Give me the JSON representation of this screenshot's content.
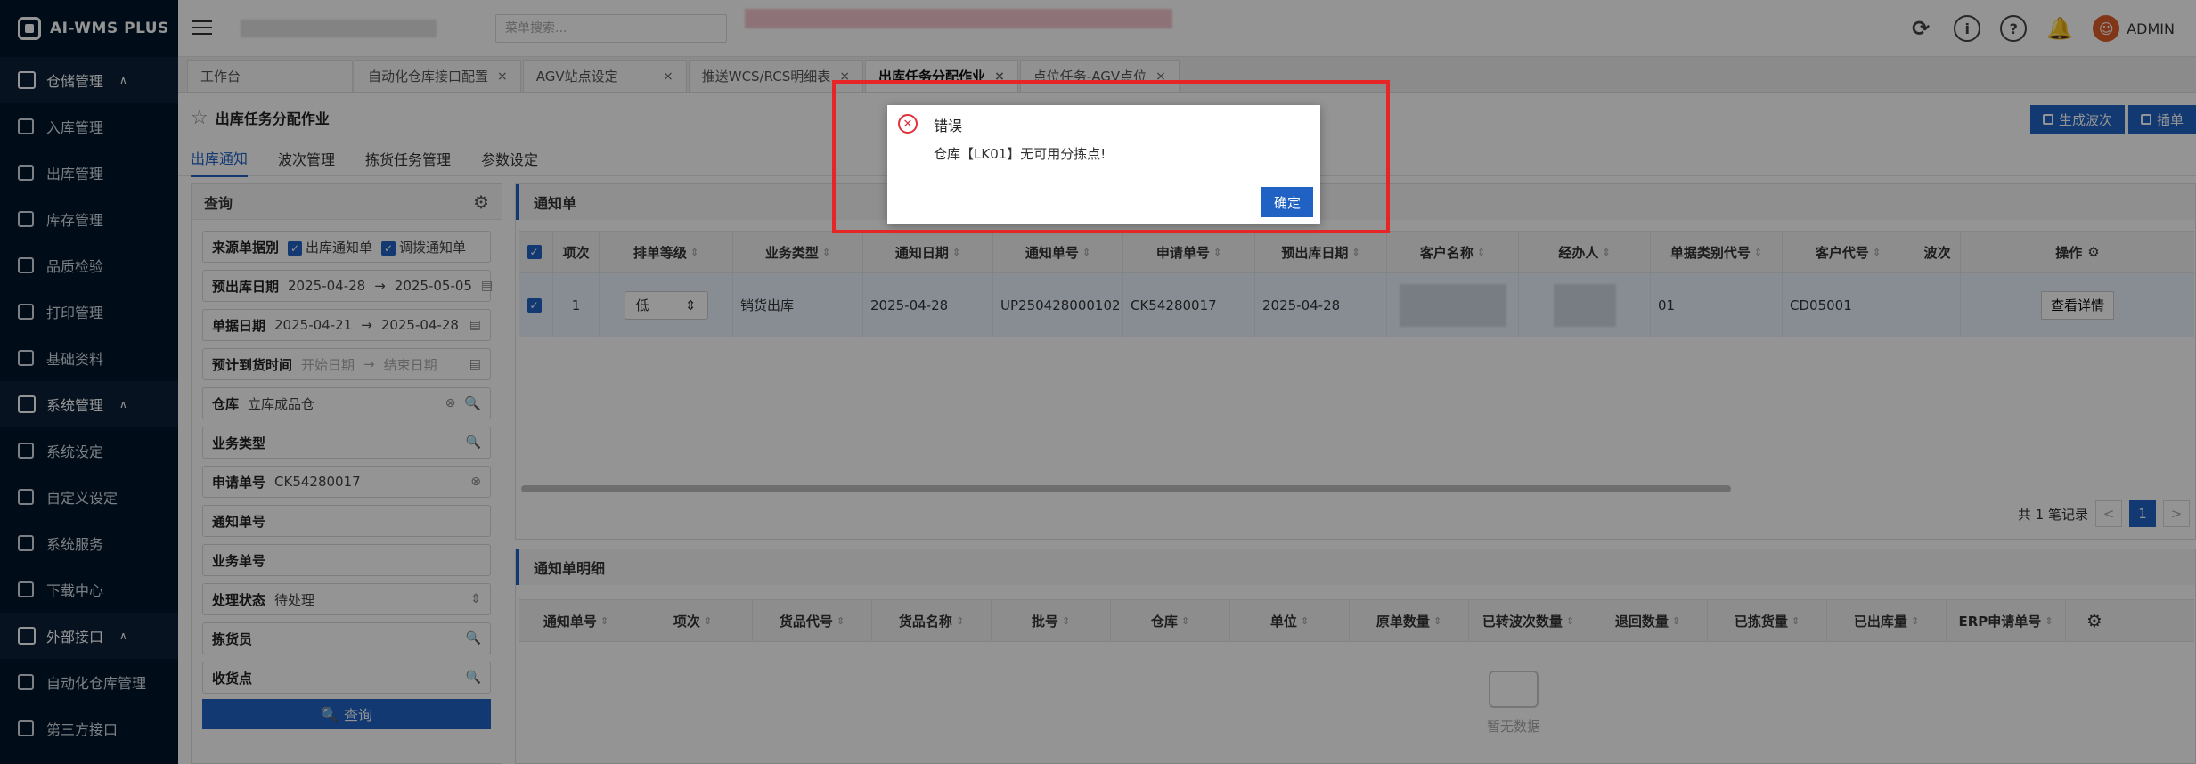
{
  "app": {
    "logo_text": "AI-WMS PLUS"
  },
  "header": {
    "search_placeholder": "菜单搜索...",
    "user_name": "ADMIN",
    "icons": [
      "refresh-icon",
      "info-icon",
      "help-icon",
      "bell-icon",
      "user-icon"
    ]
  },
  "sidebar": {
    "groups": [
      {
        "label": "仓储管理",
        "icon": "warehouse-icon",
        "items": [
          "入库管理",
          "出库管理",
          "库存管理",
          "品质检验",
          "打印管理",
          "基础资料"
        ]
      },
      {
        "label": "系统管理",
        "icon": "tools-icon",
        "items": [
          "系统设定",
          "自定义设定",
          "系统服务",
          "下载中心"
        ]
      },
      {
        "label": "外部接口",
        "icon": "interface-icon",
        "items": [
          "自动化仓库管理",
          "第三方接口"
        ]
      }
    ]
  },
  "tabs": [
    {
      "label": "工作台",
      "closable": false
    },
    {
      "label": "自动化仓库接口配置",
      "closable": true
    },
    {
      "label": "AGV站点设定",
      "closable": true
    },
    {
      "label": "推送WCS/RCS明细表",
      "closable": true
    },
    {
      "label": "出库任务分配作业",
      "closable": true,
      "active": true
    },
    {
      "label": "点位任务-AGV点位",
      "closable": true
    }
  ],
  "page": {
    "title": "出库任务分配作业",
    "btn_generate_wave": "生成波次",
    "btn_insert": "插单",
    "sub_tabs": [
      "出库通知",
      "波次管理",
      "拣货任务管理",
      "参数设定"
    ]
  },
  "query": {
    "title": "查询",
    "source_label": "来源单据别",
    "source_opt1": "出库通知单",
    "source_opt2": "调拨通知单",
    "planned_out_label": "预出库日期",
    "planned_out_from": "2025-04-28",
    "planned_out_to": "2025-05-05",
    "doc_date_label": "单据日期",
    "doc_date_from": "2025-04-21",
    "doc_date_to": "2025-04-28",
    "arrival_label": "预计到货时间",
    "arrival_start_ph": "开始日期",
    "arrival_end_ph": "结束日期",
    "warehouse_label": "仓库",
    "warehouse_value": "立库成品仓",
    "biztype_label": "业务类型",
    "apply_label": "申请单号",
    "apply_value": "CK54280017",
    "notice_label": "通知单号",
    "biz_no_label": "业务单号",
    "status_label": "处理状态",
    "status_value": "待处理",
    "picker_label": "拣货员",
    "recv_label": "收货点",
    "search_btn": "查询",
    "arrow": "→"
  },
  "notice_table": {
    "title": "通知单",
    "columns": [
      "项次",
      "排单等级",
      "业务类型",
      "通知日期",
      "通知单号",
      "申请单号",
      "预出库日期",
      "客户名称",
      "经办人",
      "单据类别代号",
      "客户代号",
      "波次",
      "操作"
    ],
    "row": {
      "index": "1",
      "priority": "低",
      "biz_type": "销货出库",
      "notice_date": "2025-04-28",
      "notice_no": "UP250428000102",
      "apply_no": "CK54280017",
      "planned_date": "2025-04-28",
      "doc_type_code": "01",
      "customer_code": "CD05001",
      "action": "查看详情"
    },
    "pager": {
      "total_text": "共 1 笔记录",
      "current": "1",
      "prev": "<",
      "next": ">"
    }
  },
  "detail_table": {
    "title": "通知单明细",
    "columns": [
      "通知单号",
      "项次",
      "货品代号",
      "货品名称",
      "批号",
      "仓库",
      "单位",
      "原单数量",
      "已转波次数量",
      "退回数量",
      "已拣货量",
      "已出库量",
      "ERP申请单号"
    ],
    "empty_text": "暂无数据"
  },
  "dialog": {
    "title": "错误",
    "message": "仓库【LK01】无可用分拣点!",
    "ok": "确定"
  },
  "colors": {
    "primary": "#1f62c4",
    "sidebar": "#001529",
    "error": "#e0323c",
    "highlight_frame": "#e62626"
  }
}
